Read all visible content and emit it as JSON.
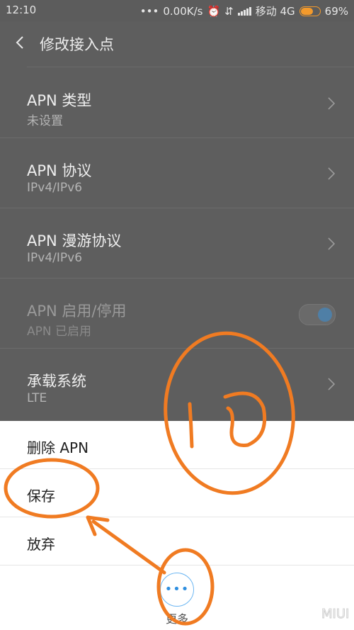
{
  "status_bar": {
    "time": "12:10",
    "dots": "•••",
    "net_speed": "0.00K/s",
    "carrier": "移动 4G",
    "battery_percent": 69,
    "battery_label": "69%"
  },
  "header": {
    "title": "修改接入点"
  },
  "settings": [
    {
      "title": "APN 类型",
      "subtitle": "未设置"
    },
    {
      "title": "APN 协议",
      "subtitle": "IPv4/IPv6"
    },
    {
      "title": "APN 漫游协议",
      "subtitle": "IPv4/IPv6"
    },
    {
      "title": "APN 启用/停用",
      "subtitle": "APN 已启用"
    },
    {
      "title": "承载系统",
      "subtitle": "LTE"
    }
  ],
  "menu": {
    "delete": "删除 APN",
    "save": "保存",
    "discard": "放弃",
    "more_label": "更多"
  },
  "annotation": {
    "step_number": "10",
    "color": "#f07b22"
  },
  "colors": {
    "accent": "#2f8fe0",
    "battery": "#f39a2c"
  },
  "icons": [
    "back-icon",
    "more-icon",
    "chevron-right-icon",
    "toggle-switch",
    "battery-icon",
    "signal-icon"
  ]
}
